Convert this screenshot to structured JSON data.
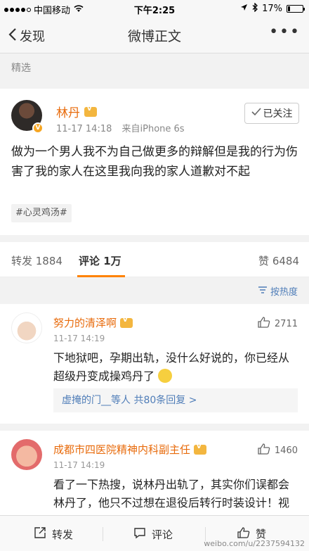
{
  "status_bar": {
    "carrier": "中国移动",
    "time": "下午2:25",
    "battery": "17%",
    "battery_level": 0.17
  },
  "nav": {
    "back_label": "发现",
    "title": "微博正文",
    "more_label": "•••"
  },
  "section_label": "精选",
  "post": {
    "author": "林丹",
    "time": "11-17 14:18",
    "source": "来自iPhone 6s",
    "follow_label": "已关注",
    "text": "做为一个男人我不为自己做更多的辩解但是我的行为伤害了我的家人在这里我向我的家人道歉对不起",
    "tag": "#心灵鸡汤#"
  },
  "tabs": {
    "repost": "转发 1884",
    "comment": "评论 1万",
    "like": "赞 6484"
  },
  "sort_label": "按热度",
  "comments": [
    {
      "author": "努力的清泽啊",
      "time": "11-17 14:19",
      "likes": "2711",
      "text": "下地狱吧，孕期出轨，没什么好说的，你已经从超级丹变成操鸡丹了",
      "reply_summary": "虚掩的门__等人  共80条回复 >"
    },
    {
      "author": "成都市四医院精神内科副主任",
      "time": "11-17 14:19",
      "likes": "1460",
      "text": "看了一下热搜，说林丹出轨了，其实你们误都会林丹了，他只不过想在退役后转行时装设计！视频中显然是他在帮服装模特量三"
    }
  ],
  "bottom_bar": {
    "repost": "转发",
    "comment": "评论",
    "like": "赞"
  },
  "watermark": "weibo.com/u/2237594132"
}
